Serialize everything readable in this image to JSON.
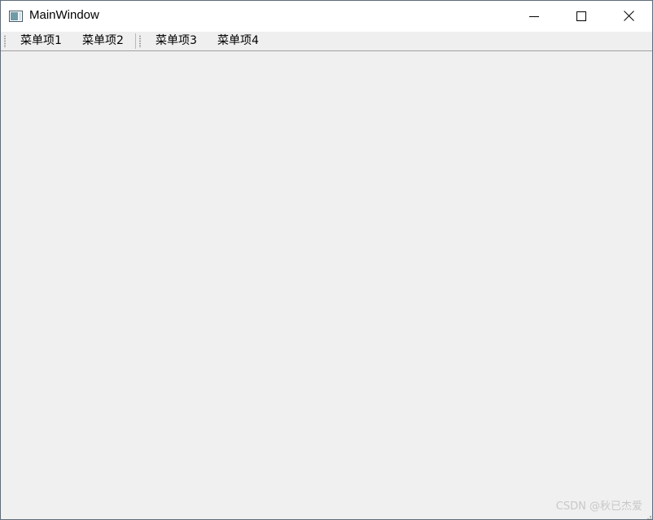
{
  "window": {
    "title": "MainWindow",
    "icon": "window-icon"
  },
  "caption_buttons": {
    "minimize": "minimize-icon",
    "maximize": "maximize-icon",
    "close": "close-icon"
  },
  "toolbar": {
    "items": [
      {
        "label": "菜单项1"
      },
      {
        "label": "菜单项2"
      },
      {
        "label": "菜单项3"
      },
      {
        "label": "菜单项4"
      }
    ]
  },
  "watermark": {
    "text": "CSDN @秋已杰爱"
  },
  "colors": {
    "titlebar_bg": "#ffffff",
    "client_bg": "#f0f0f0",
    "border": "#5f6b78"
  }
}
